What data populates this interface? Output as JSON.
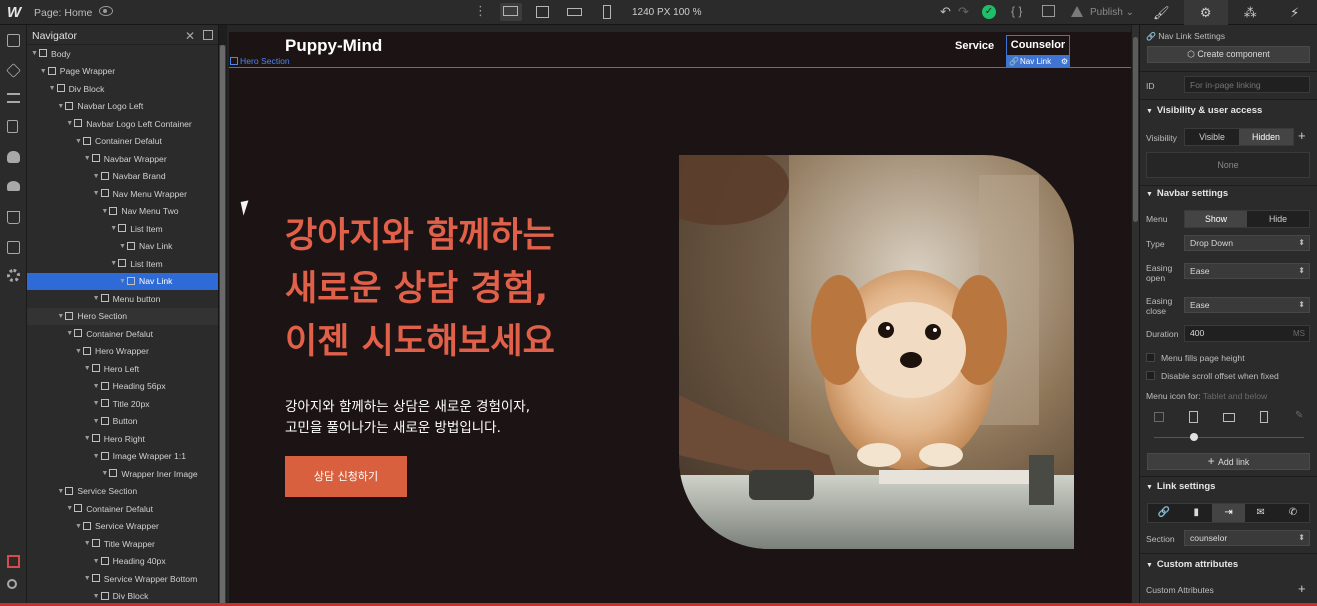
{
  "topbar": {
    "logo": "W",
    "page_label": "Page: Home",
    "canvas_size": "1240 PX  100 %",
    "publish": "Publish ⌄",
    "undo": "↶",
    "redo": "↷",
    "status": "✓",
    "code": "{ }",
    "right_tabs": [
      "🖌",
      "⚙",
      "⁂",
      "⚡"
    ]
  },
  "navigator": {
    "title": "Navigator",
    "items": [
      {
        "label": "Body",
        "depth": 0
      },
      {
        "label": "Page Wrapper",
        "depth": 1
      },
      {
        "label": "Div Block",
        "depth": 2
      },
      {
        "label": "Navbar Logo Left",
        "depth": 3
      },
      {
        "label": "Navbar Logo Left Container",
        "depth": 4
      },
      {
        "label": "Container Defalut",
        "depth": 5
      },
      {
        "label": "Navbar Wrapper",
        "depth": 6
      },
      {
        "label": "Navbar Brand",
        "depth": 7
      },
      {
        "label": "Nav Menu Wrapper",
        "depth": 7
      },
      {
        "label": "Nav Menu Two",
        "depth": 8
      },
      {
        "label": "List Item",
        "depth": 9
      },
      {
        "label": "Nav Link",
        "depth": 10
      },
      {
        "label": "List Item",
        "depth": 9
      },
      {
        "label": "Nav Link",
        "depth": 10,
        "selected": true
      },
      {
        "label": "Menu button",
        "depth": 7
      },
      {
        "label": "Hero Section",
        "depth": 3,
        "group": true
      },
      {
        "label": "Container Defalut",
        "depth": 4
      },
      {
        "label": "Hero Wrapper",
        "depth": 5
      },
      {
        "label": "Hero Left",
        "depth": 6
      },
      {
        "label": "Heading 56px",
        "depth": 7
      },
      {
        "label": "Title 20px",
        "depth": 7
      },
      {
        "label": "Button",
        "depth": 7
      },
      {
        "label": "Hero Right",
        "depth": 6
      },
      {
        "label": "Image Wrapper 1:1",
        "depth": 7
      },
      {
        "label": "Wrapper Iner Image",
        "depth": 8
      },
      {
        "label": "Service Section",
        "depth": 3
      },
      {
        "label": "Container Defalut",
        "depth": 4
      },
      {
        "label": "Service Wrapper",
        "depth": 5
      },
      {
        "label": "Title Wrapper",
        "depth": 6
      },
      {
        "label": "Heading 40px",
        "depth": 7
      },
      {
        "label": "Service Wrapper Bottom",
        "depth": 6
      },
      {
        "label": "Div Block",
        "depth": 7
      }
    ]
  },
  "canvas": {
    "brand": "Puppy-Mind",
    "hero_tag": "Hero Section",
    "nav_service": "Service",
    "nav_counselor": "Counselor",
    "nav_link_tag": "Nav Link",
    "heading_lines": [
      "강아지와 함께하는",
      "새로운 상담 경험,",
      "이젠 시도해보세요"
    ],
    "subtitle_lines": [
      "강아지와 함께하는 상담은 새로운 경험이자,",
      "고민을 풀어나가는 새로운 방법입니다."
    ],
    "cta_label": "상담 신청하기",
    "accent_color": "#e0604a"
  },
  "panel": {
    "settings_title": "Nav Link Settings",
    "create_component": "Create component",
    "id_label": "ID",
    "id_placeholder": "For in-page linking",
    "visibility_section": "Visibility & user access",
    "visibility_label": "Visibility",
    "visible": "Visible",
    "hidden": "Hidden",
    "none": "None",
    "navbar_section": "Navbar settings",
    "menu_label": "Menu",
    "show": "Show",
    "hide": "Hide",
    "type_label": "Type",
    "type_value": "Drop Down",
    "easing_open_label": "Easing open",
    "easing_open_value": "Ease",
    "easing_close_label": "Easing close",
    "easing_close_value": "Ease",
    "duration_label": "Duration",
    "duration_value": "400",
    "duration_unit": "MS",
    "menu_fills": "Menu fills page height",
    "disable_scroll": "Disable scroll offset when fixed",
    "menu_icon_label": "Menu icon for:",
    "menu_icon_hint": "Tablet and below",
    "add_link": "Add link",
    "link_section": "Link settings",
    "section_label": "Section",
    "section_value": "counselor",
    "custom_attrs_section": "Custom attributes",
    "custom_attrs_label": "Custom Attributes"
  }
}
